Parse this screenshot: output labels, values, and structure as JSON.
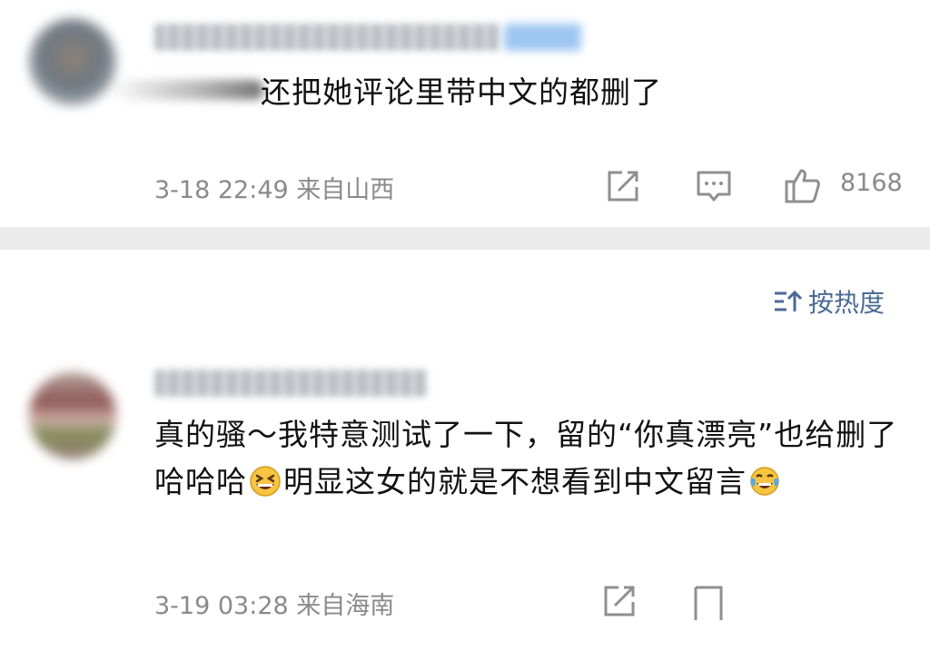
{
  "comments": [
    {
      "text": "还把她评论里带中文的都删了",
      "meta": "3-18 22:49 来自山西",
      "like_count": "8168"
    },
    {
      "text_part1": "真的骚～我特意测试了一下，留的“你真漂亮”也给删了哈哈哈",
      "text_part2": "明显这女的就是不想看到中文留言",
      "meta": "3-19 03:28 来自海南"
    }
  ],
  "sort": {
    "label": "按热度"
  },
  "colors": {
    "meta_gray": "#8a8a8a",
    "sort_blue": "#4a6a93",
    "divider": "#ebebeb"
  },
  "icons": [
    "share-icon",
    "reply-icon",
    "like-icon",
    "sort-icon",
    "grin-emoji",
    "tears-of-joy-emoji"
  ]
}
